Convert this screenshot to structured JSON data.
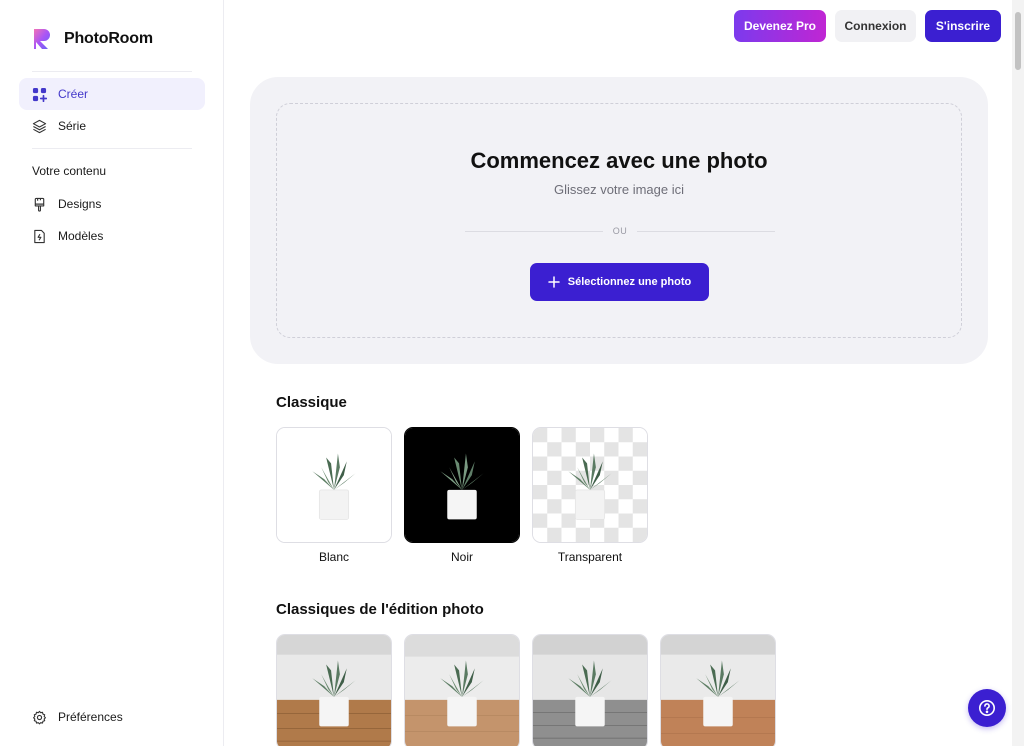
{
  "brand": {
    "name": "PhotoRoom"
  },
  "sidebar": {
    "items": [
      {
        "label": "Créer",
        "icon": "grid-plus-icon",
        "active": true
      },
      {
        "label": "Série",
        "icon": "layers-icon",
        "active": false
      }
    ],
    "section_label": "Votre contenu",
    "content_items": [
      {
        "label": "Designs",
        "icon": "brush-icon"
      },
      {
        "label": "Modèles",
        "icon": "template-icon"
      }
    ],
    "footer_item": {
      "label": "Préférences",
      "icon": "gear-icon"
    }
  },
  "header": {
    "pro_label": "Devenez Pro",
    "login_label": "Connexion",
    "signup_label": "S'inscrire"
  },
  "upload": {
    "title": "Commencez avec une photo",
    "subtitle": "Glissez votre image ici",
    "or_text": "OU",
    "button_label": "Sélectionnez une photo"
  },
  "classique": {
    "title": "Classique",
    "cards": [
      {
        "label": "Blanc",
        "background": "white"
      },
      {
        "label": "Noir",
        "background": "black"
      },
      {
        "label": "Transparent",
        "background": "checker"
      }
    ]
  },
  "edition": {
    "title": "Classiques de l'édition photo",
    "cards": [
      {
        "floor": "#b07a4a"
      },
      {
        "floor": "#b88660"
      },
      {
        "floor": "#8a8a8a"
      },
      {
        "floor": "#b57a4e"
      }
    ]
  },
  "colors": {
    "accent": "#3b1fd1",
    "active_bg": "#f1f0fd",
    "panel_bg": "#f2f2f6"
  }
}
